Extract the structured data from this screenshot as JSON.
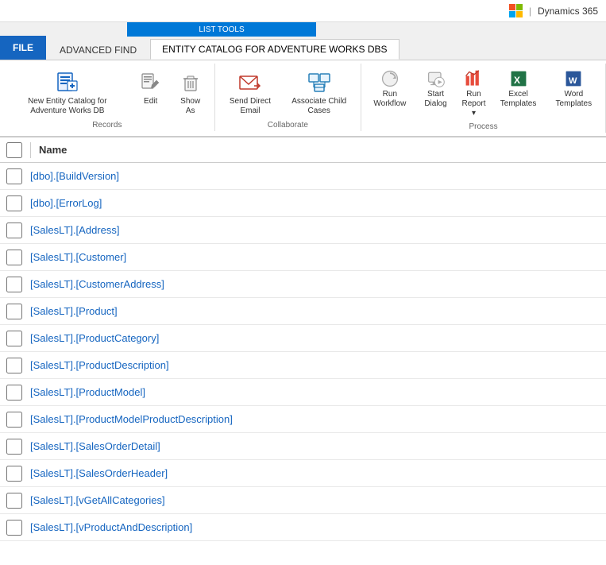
{
  "topbar": {
    "microsoft": "Microsoft",
    "separator": "|",
    "dynamics": "Dynamics 365"
  },
  "tabs": {
    "file": "FILE",
    "advanced_find": "ADVANCED FIND",
    "entity_catalog": "ENTITY CATALOG FOR ADVENTURE WORKS DBS",
    "list_tools": "LIST TOOLS"
  },
  "ribbon": {
    "records_group": {
      "label": "Records",
      "new_entity_label": "New Entity Catalog for Adventure Works DB",
      "edit_label": "Edit",
      "delete_label": "Show As"
    },
    "collaborate_group": {
      "label": "Collaborate",
      "send_direct_email": "Send Direct Email",
      "associate_child_cases": "Associate Child Cases"
    },
    "process_group": {
      "label": "Process",
      "run_workflow": "Run Workflow",
      "start_dialog": "Start Dialog",
      "run_report": "Run Report",
      "excel_templates": "Excel Templates",
      "word_templates": "Word Templates"
    }
  },
  "grid": {
    "col_name": "Name",
    "rows": [
      "[dbo].[BuildVersion]",
      "[dbo].[ErrorLog]",
      "[SalesLT].[Address]",
      "[SalesLT].[Customer]",
      "[SalesLT].[CustomerAddress]",
      "[SalesLT].[Product]",
      "[SalesLT].[ProductCategory]",
      "[SalesLT].[ProductDescription]",
      "[SalesLT].[ProductModel]",
      "[SalesLT].[ProductModelProductDescription]",
      "[SalesLT].[SalesOrderDetail]",
      "[SalesLT].[SalesOrderHeader]",
      "[SalesLT].[vGetAllCategories]",
      "[SalesLT].[vProductAndDescription]"
    ]
  }
}
